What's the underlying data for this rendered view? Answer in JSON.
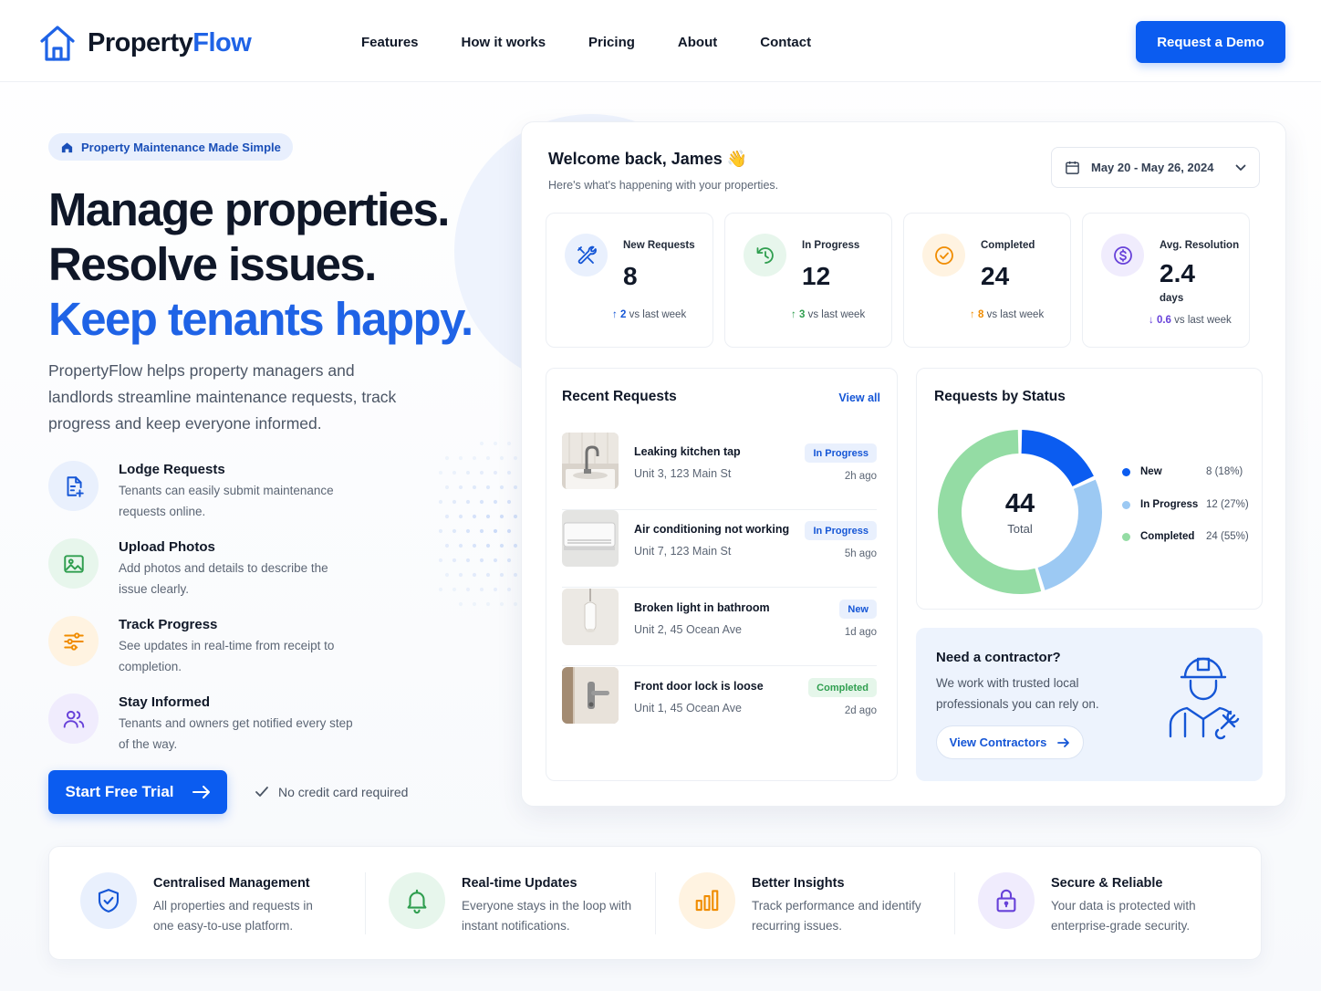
{
  "brand": {
    "name_a": "Property",
    "name_b": "Flow"
  },
  "nav": {
    "items": [
      "Features",
      "How it works",
      "Pricing",
      "About",
      "Contact"
    ],
    "demo_label": "Request a Demo"
  },
  "hero": {
    "badge": "Property Maintenance Made Simple",
    "line1": "Manage properties.",
    "line2": "Resolve issues.",
    "line3": "Keep tenants happy.",
    "lead": "PropertyFlow helps property managers and landlords streamline maintenance requests, track progress and keep everyone informed.",
    "features": [
      {
        "title": "Lodge Requests",
        "desc": "Tenants can easily submit maintenance requests online.",
        "icon": "file-plus-icon"
      },
      {
        "title": "Upload Photos",
        "desc": "Add photos and details to describe the issue clearly.",
        "icon": "image-icon"
      },
      {
        "title": "Track Progress",
        "desc": "See updates in real-time from receipt to completion.",
        "icon": "sliders-icon"
      },
      {
        "title": "Stay Informed",
        "desc": "Tenants and owners get notified every step of the way.",
        "icon": "users-icon"
      }
    ],
    "cta": "Start Free Trial",
    "note": "No credit card required"
  },
  "dashboard": {
    "welcome": "Welcome back, James 👋",
    "subtitle": "Here's what's happening with your properties.",
    "date_range": "May 20 - May 26, 2024",
    "stats": [
      {
        "label": "New Requests",
        "value": "8",
        "delta": "2",
        "trend": "vs last week",
        "direction": "up",
        "color": "#1556d6",
        "icon": "tools-icon"
      },
      {
        "label": "In Progress",
        "value": "12",
        "delta": "3",
        "trend": "vs last week",
        "direction": "up",
        "color": "#2f9e4f",
        "icon": "clock-icon"
      },
      {
        "label": "Completed",
        "value": "24",
        "delta": "8",
        "trend": "vs last week",
        "direction": "up",
        "color": "#f08c00",
        "icon": "check-circle-icon"
      },
      {
        "label": "Avg. Resolution",
        "value": "2.4",
        "unit": "days",
        "delta": "0.6",
        "trend": "vs last week",
        "direction": "down",
        "color": "#6741d9",
        "icon": "dollar-icon"
      }
    ],
    "recent": {
      "title": "Recent Requests",
      "view_all": "View all",
      "items": [
        {
          "title": "Leaking kitchen tap",
          "address": "Unit 3, 123 Main St",
          "status": "In Progress",
          "time": "2h ago"
        },
        {
          "title": "Air conditioning not working",
          "address": "Unit 7, 123 Main St",
          "status": "In Progress",
          "time": "5h ago"
        },
        {
          "title": "Broken light in bathroom",
          "address": "Unit 2, 45 Ocean Ave",
          "status": "New",
          "time": "1d ago"
        },
        {
          "title": "Front door lock is loose",
          "address": "Unit 1, 45 Ocean Ave",
          "status": "Completed",
          "time": "2d ago"
        }
      ]
    },
    "status_chart": {
      "title": "Requests by Status",
      "total": "44",
      "total_label": "Total",
      "segments": [
        {
          "name": "New",
          "value": 8,
          "label": "8 (18%)",
          "color": "#0b5cf0"
        },
        {
          "name": "In Progress",
          "value": 12,
          "label": "12 (27%)",
          "color": "#9cc9f3"
        },
        {
          "name": "Completed",
          "value": 24,
          "label": "24 (55%)",
          "color": "#94dca4"
        }
      ]
    },
    "contractor": {
      "title": "Need a contractor?",
      "desc": "We work with trusted local professionals you can rely on.",
      "button": "View Contractors"
    }
  },
  "benefits": [
    {
      "title": "Centralised Management",
      "desc": "All properties and requests in one easy-to-use platform.",
      "icon": "shield-check-icon"
    },
    {
      "title": "Real-time Updates",
      "desc": "Everyone stays in the loop with instant notifications.",
      "icon": "bell-icon"
    },
    {
      "title": "Better Insights",
      "desc": "Track performance and identify recurring issues.",
      "icon": "bar-chart-icon"
    },
    {
      "title": "Secure & Reliable",
      "desc": "Your data is protected with enterprise-grade security.",
      "icon": "lock-icon"
    }
  ]
}
